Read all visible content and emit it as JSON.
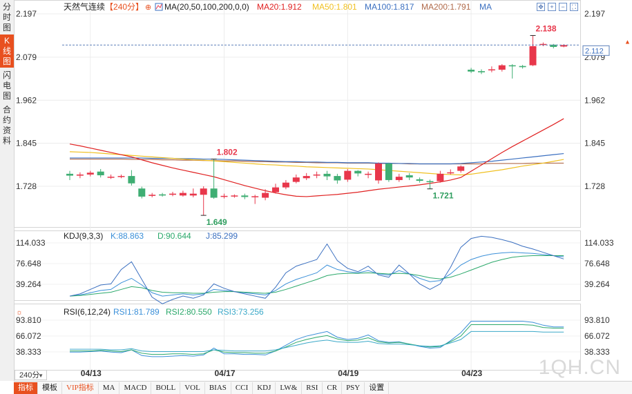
{
  "left_tabs": [
    {
      "label": "分时图",
      "active": false
    },
    {
      "label": "K线图",
      "active": true
    },
    {
      "label": "闪电图",
      "active": false
    },
    {
      "label": "合约资料",
      "active": false
    }
  ],
  "header": {
    "title": "天然气连续",
    "period_tag": "【240分】",
    "ma_params": "MA(20,50,100,200,0,0)",
    "ma20": "MA20:1.912",
    "ma50": "MA50:1.801",
    "ma100": "MA100:1.817",
    "ma200": "MA200:1.791",
    "ma_extra": "MA"
  },
  "kdj_header": {
    "params": "KDJ(9,3,3)",
    "k": "K:88.863",
    "d": "D:90.644",
    "j": "J:85.299"
  },
  "rsi_header": {
    "params": "RSI(6,12,24)",
    "rsi1": "RSI1:81.789",
    "rsi2": "RSI2:80.550",
    "rsi3": "RSI3:73.256"
  },
  "price_axis": [
    "2.197",
    "2.079",
    "1.962",
    "1.845",
    "1.728"
  ],
  "kdj_axis": [
    "114.033",
    "76.648",
    "39.264"
  ],
  "rsi_axis": [
    "93.810",
    "66.072",
    "38.333"
  ],
  "current_price": "2.112",
  "annotations": {
    "high1": "1.802",
    "low1": "1.649",
    "low2": "1.721",
    "high2": "2.138"
  },
  "x_labels": [
    "04/13",
    "04/17",
    "04/19",
    "04/23"
  ],
  "period_selector": "240分",
  "bottom_tabs": [
    "指标",
    "模板",
    "VIP指标",
    "MA",
    "MACD",
    "BOLL",
    "VOL",
    "BIAS",
    "CCI",
    "KDJ",
    "LW&",
    "RSI",
    "CR",
    "PSY",
    "设置"
  ],
  "watermark": "1QH.CN",
  "colors": {
    "up": "#e8374b",
    "down": "#3fae73",
    "ma20": "#e02020",
    "ma50": "#f0c020",
    "ma100": "#3a6fc0",
    "ma200": "#b06a4a",
    "accent": "#e8501f"
  },
  "chart_data": {
    "type": "candlestick",
    "candles": [
      {
        "o": 1.762,
        "c": 1.757,
        "h": 1.77,
        "l": 1.745
      },
      {
        "o": 1.757,
        "c": 1.76,
        "h": 1.766,
        "l": 1.75
      },
      {
        "o": 1.76,
        "c": 1.765,
        "h": 1.77,
        "l": 1.755
      },
      {
        "o": 1.768,
        "c": 1.758,
        "h": 1.775,
        "l": 1.752
      },
      {
        "o": 1.752,
        "c": 1.754,
        "h": 1.76,
        "l": 1.748
      },
      {
        "o": 1.755,
        "c": 1.756,
        "h": 1.76,
        "l": 1.75
      },
      {
        "o": 1.756,
        "c": 1.736,
        "h": 1.772,
        "l": 1.73
      },
      {
        "o": 1.722,
        "c": 1.7,
        "h": 1.727,
        "l": 1.695
      },
      {
        "o": 1.702,
        "c": 1.705,
        "h": 1.71,
        "l": 1.698
      },
      {
        "o": 1.706,
        "c": 1.703,
        "h": 1.71,
        "l": 1.7
      },
      {
        "o": 1.705,
        "c": 1.708,
        "h": 1.713,
        "l": 1.701
      },
      {
        "o": 1.703,
        "c": 1.71,
        "h": 1.716,
        "l": 1.7
      },
      {
        "o": 1.703,
        "c": 1.708,
        "h": 1.722,
        "l": 1.698
      },
      {
        "o": 1.705,
        "c": 1.722,
        "h": 1.728,
        "l": 1.649
      },
      {
        "o": 1.722,
        "c": 1.697,
        "h": 1.802,
        "l": 1.694
      },
      {
        "o": 1.7,
        "c": 1.702,
        "h": 1.708,
        "l": 1.695
      },
      {
        "o": 1.701,
        "c": 1.703,
        "h": 1.706,
        "l": 1.697
      },
      {
        "o": 1.703,
        "c": 1.699,
        "h": 1.708,
        "l": 1.693
      },
      {
        "o": 1.7,
        "c": 1.701,
        "h": 1.705,
        "l": 1.68
      },
      {
        "o": 1.697,
        "c": 1.71,
        "h": 1.72,
        "l": 1.69
      },
      {
        "o": 1.712,
        "c": 1.725,
        "h": 1.735,
        "l": 1.708
      },
      {
        "o": 1.725,
        "c": 1.738,
        "h": 1.745,
        "l": 1.72
      },
      {
        "o": 1.74,
        "c": 1.752,
        "h": 1.76,
        "l": 1.736
      },
      {
        "o": 1.75,
        "c": 1.756,
        "h": 1.764,
        "l": 1.745
      },
      {
        "o": 1.758,
        "c": 1.76,
        "h": 1.768,
        "l": 1.75
      },
      {
        "o": 1.762,
        "c": 1.755,
        "h": 1.77,
        "l": 1.745
      },
      {
        "o": 1.756,
        "c": 1.744,
        "h": 1.762,
        "l": 1.735
      },
      {
        "o": 1.746,
        "c": 1.77,
        "h": 1.775,
        "l": 1.74
      },
      {
        "o": 1.77,
        "c": 1.763,
        "h": 1.772,
        "l": 1.755
      },
      {
        "o": 1.76,
        "c": 1.762,
        "h": 1.768,
        "l": 1.75
      },
      {
        "o": 1.744,
        "c": 1.79,
        "h": 1.793,
        "l": 1.735
      },
      {
        "o": 1.79,
        "c": 1.745,
        "h": 1.792,
        "l": 1.74
      },
      {
        "o": 1.745,
        "c": 1.754,
        "h": 1.762,
        "l": 1.74
      },
      {
        "o": 1.758,
        "c": 1.752,
        "h": 1.764,
        "l": 1.745
      },
      {
        "o": 1.747,
        "c": 1.743,
        "h": 1.752,
        "l": 1.738
      },
      {
        "o": 1.742,
        "c": 1.741,
        "h": 1.746,
        "l": 1.721
      },
      {
        "o": 1.742,
        "c": 1.762,
        "h": 1.77,
        "l": 1.738
      },
      {
        "o": 1.764,
        "c": 1.766,
        "h": 1.774,
        "l": 1.76
      },
      {
        "o": 1.77,
        "c": 1.782,
        "h": 1.785,
        "l": 1.765
      },
      {
        "o": 2.045,
        "c": 2.04,
        "h": 2.05,
        "l": 2.036
      },
      {
        "o": 2.041,
        "c": 2.038,
        "h": 2.046,
        "l": 2.033
      },
      {
        "o": 2.045,
        "c": 2.046,
        "h": 2.054,
        "l": 2.038
      },
      {
        "o": 2.045,
        "c": 2.057,
        "h": 2.06,
        "l": 2.04
      },
      {
        "o": 2.057,
        "c": 2.055,
        "h": 2.06,
        "l": 2.021
      },
      {
        "o": 2.055,
        "c": 2.052,
        "h": 2.058,
        "l": 2.048
      },
      {
        "o": 2.057,
        "c": 2.109,
        "h": 2.138,
        "l": 2.055
      },
      {
        "o": 2.113,
        "c": 2.115,
        "h": 2.119,
        "l": 2.109
      },
      {
        "o": 2.113,
        "c": 2.107,
        "h": 2.115,
        "l": 2.103
      },
      {
        "o": 2.108,
        "c": 2.112,
        "h": 2.114,
        "l": 2.106
      }
    ],
    "ma20": [
      1.843,
      1.838,
      1.832,
      1.826,
      1.82,
      1.814,
      1.808,
      1.8,
      1.792,
      1.785,
      1.778,
      1.772,
      1.766,
      1.76,
      1.754,
      1.746,
      1.738,
      1.73,
      1.723,
      1.716,
      1.71,
      1.705,
      1.701,
      1.7,
      1.702,
      1.704,
      1.706,
      1.709,
      1.712,
      1.716,
      1.72,
      1.723,
      1.726,
      1.729,
      1.732,
      1.736,
      1.74,
      1.745,
      1.752,
      1.769,
      1.786,
      1.803,
      1.82,
      1.836,
      1.851,
      1.866,
      1.881,
      1.896,
      1.912
    ],
    "ma50": [
      1.822,
      1.821,
      1.82,
      1.818,
      1.816,
      1.814,
      1.812,
      1.81,
      1.808,
      1.806,
      1.804,
      1.802,
      1.8,
      1.799,
      1.797,
      1.795,
      1.793,
      1.791,
      1.789,
      1.787,
      1.786,
      1.784,
      1.783,
      1.781,
      1.78,
      1.779,
      1.778,
      1.777,
      1.776,
      1.775,
      1.773,
      1.771,
      1.769,
      1.767,
      1.765,
      1.763,
      1.761,
      1.76,
      1.759,
      1.761,
      1.765,
      1.769,
      1.773,
      1.778,
      1.783,
      1.787,
      1.791,
      1.796,
      1.801
    ],
    "ma100": [
      1.805,
      1.805,
      1.805,
      1.805,
      1.805,
      1.805,
      1.805,
      1.805,
      1.804,
      1.804,
      1.804,
      1.803,
      1.803,
      1.802,
      1.802,
      1.801,
      1.8,
      1.799,
      1.798,
      1.797,
      1.796,
      1.795,
      1.795,
      1.794,
      1.794,
      1.793,
      1.793,
      1.792,
      1.792,
      1.792,
      1.791,
      1.791,
      1.79,
      1.79,
      1.789,
      1.789,
      1.789,
      1.789,
      1.79,
      1.792,
      1.794,
      1.796,
      1.799,
      1.802,
      1.805,
      1.808,
      1.811,
      1.814,
      1.817
    ],
    "ma200": [
      1.802,
      1.802,
      1.802,
      1.802,
      1.802,
      1.802,
      1.801,
      1.801,
      1.801,
      1.8,
      1.8,
      1.799,
      1.799,
      1.798,
      1.798,
      1.797,
      1.797,
      1.796,
      1.795,
      1.795,
      1.794,
      1.794,
      1.793,
      1.793,
      1.792,
      1.792,
      1.792,
      1.791,
      1.791,
      1.791,
      1.79,
      1.79,
      1.79,
      1.789,
      1.789,
      1.789,
      1.789,
      1.789,
      1.789,
      1.789,
      1.789,
      1.79,
      1.79,
      1.79,
      1.79,
      1.791,
      1.791,
      1.791,
      1.791
    ],
    "kdj": {
      "k": [
        18,
        20,
        24,
        28,
        30,
        42,
        50,
        38,
        24,
        18,
        20,
        22,
        20,
        22,
        30,
        28,
        26,
        24,
        22,
        20,
        28,
        40,
        48,
        54,
        60,
        74,
        66,
        62,
        60,
        64,
        58,
        56,
        64,
        58,
        50,
        44,
        46,
        58,
        74,
        84,
        90,
        94,
        96,
        97,
        96,
        95,
        93,
        91,
        89
      ],
      "d": [
        18,
        19,
        21,
        23,
        25,
        30,
        35,
        33,
        28,
        25,
        24,
        24,
        23,
        23,
        25,
        26,
        26,
        25,
        24,
        23,
        25,
        30,
        36,
        42,
        48,
        55,
        58,
        59,
        59,
        60,
        59,
        58,
        59,
        58,
        55,
        51,
        49,
        52,
        58,
        65,
        72,
        79,
        84,
        88,
        90,
        91,
        91,
        91,
        91
      ],
      "j": [
        18,
        22,
        30,
        38,
        40,
        66,
        80,
        48,
        16,
        4,
        12,
        18,
        14,
        20,
        40,
        32,
        26,
        22,
        18,
        14,
        34,
        60,
        72,
        78,
        84,
        112,
        82,
        68,
        62,
        72,
        56,
        52,
        74,
        58,
        40,
        30,
        40,
        70,
        106,
        122,
        126,
        124,
        120,
        115,
        108,
        103,
        97,
        91,
        85
      ]
    },
    "rsi": {
      "rsi1": [
        38,
        38,
        39,
        40,
        38,
        37,
        42,
        32,
        30,
        30,
        31,
        32,
        31,
        33,
        45,
        35,
        35,
        34,
        34,
        33,
        40,
        50,
        60,
        66,
        70,
        74,
        64,
        60,
        62,
        68,
        58,
        55,
        56,
        52,
        48,
        45,
        46,
        58,
        72,
        92,
        92,
        92,
        92,
        92,
        92,
        90,
        85,
        82,
        82
      ],
      "rsi2": [
        40,
        40,
        40,
        41,
        40,
        39,
        42,
        36,
        34,
        34,
        35,
        35,
        34,
        35,
        42,
        38,
        37,
        37,
        36,
        36,
        40,
        47,
        55,
        60,
        64,
        67,
        61,
        58,
        59,
        63,
        56,
        54,
        55,
        52,
        49,
        47,
        48,
        56,
        66,
        86,
        86,
        86,
        86,
        86,
        86,
        85,
        81,
        80,
        80
      ],
      "rsi3": [
        43,
        43,
        43,
        43,
        42,
        42,
        44,
        40,
        39,
        39,
        39,
        39,
        39,
        39,
        42,
        41,
        40,
        40,
        40,
        40,
        42,
        46,
        50,
        54,
        57,
        59,
        56,
        55,
        55,
        57,
        53,
        52,
        52,
        51,
        49,
        48,
        49,
        54,
        60,
        74,
        74,
        74,
        74,
        74,
        74,
        74,
        73,
        73,
        73
      ]
    }
  }
}
